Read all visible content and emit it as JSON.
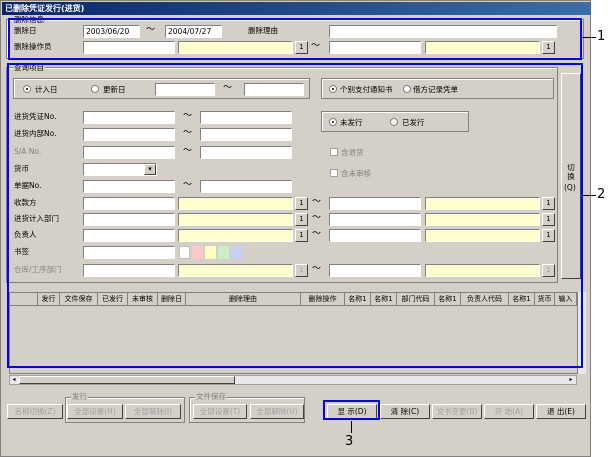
{
  "window": {
    "title": "已删除凭证发行(进货)"
  },
  "delete_info": {
    "group_title": "删除信息",
    "date_label": "删除日",
    "date_from": "2003/06/20",
    "date_sep": "～",
    "date_to": "2004/07/27",
    "reason_label": "删除理由",
    "operator_label": "删除操作员",
    "op_sep": "～",
    "lookup_btn": "1"
  },
  "query": {
    "group_title": "查询项目",
    "radio_record_date": "计入日",
    "radio_update_date": "更新日",
    "range_sep": "～",
    "radio_payment_notice": "个别支付通知书",
    "radio_debit_record": "借方记录凭单",
    "radio_unissued": "未发行",
    "radio_issued": "已发行",
    "chk_include_return": "含退货",
    "chk_include_unreviewed": "含未审核",
    "switch_label": "切换",
    "switch_key": "(Q)",
    "lookup_btn": "1",
    "fields": {
      "voucher_no": "进货凭证No.",
      "internal_no": "进货内部No.",
      "sa_no": "S/A No.",
      "currency": "货币",
      "doc_no": "单据No.",
      "payee": "收款方",
      "purchase_dept": "进货计入部门",
      "person": "负责人",
      "bookmark": "书签",
      "warehouse": "仓库/工序部门"
    }
  },
  "table": {
    "columns": [
      "",
      "发行",
      "文件保存",
      "已发行",
      "未审核",
      "删除日",
      "删除理由",
      "删除操作",
      "名称1",
      "名称1",
      "部门代码",
      "名称1",
      "负责人代码",
      "名称1",
      "货币",
      "输入"
    ]
  },
  "bottom": {
    "issue_group": "发行",
    "file_group": "文件保存",
    "btn_name_switch": "名称切换(Z)",
    "btn_select_all_issue": "全部设置(H)",
    "btn_clear_all_issue": "全部解除(I)",
    "btn_select_all_file": "全部设置(T)",
    "btn_clear_all_file": "全部解除(U)",
    "btn_display": "显 示(D)",
    "btn_clear": "清 除(C)",
    "btn_text_change": "文书变更(B)",
    "btn_start": "开 始(A)",
    "btn_exit": "退 出(E)"
  },
  "callouts": {
    "c1": "1",
    "c2": "2",
    "c3": "3"
  },
  "colors": {
    "accent": "#0000ff",
    "highlight_field": "#ffffcc",
    "title_bar": "#0a246a"
  }
}
